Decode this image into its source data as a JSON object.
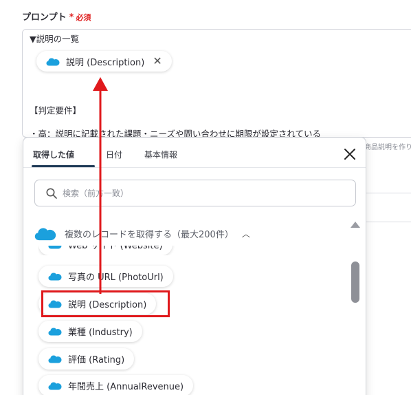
{
  "field": {
    "label": "プロンプト",
    "asterisk": "*",
    "required": "必須"
  },
  "prompt": {
    "line1": "▼説明の一覧",
    "chip_label": "説明 (Description)",
    "line2": "【判定要件】",
    "line3": "・高：説明に記載された課題・ニーズや問い合わせに期限が設定されている"
  },
  "background_hint": "商品説明を作り",
  "popup": {
    "tabs": [
      "取得した値",
      "日付",
      "基本情報"
    ],
    "search_placeholder": "検索（前方一致）",
    "group_title": "複数のレコードを取得する（最大200件）",
    "items": [
      "Web サイト (Website)",
      "写真の URL (PhotoUrl)",
      "説明 (Description)",
      "業種 (Industry)",
      "評価 (Rating)",
      "年間売上 (AnnualRevenue)"
    ]
  },
  "colors": {
    "salesforce_blue": "#1ba0dd",
    "highlight_red": "#e0191c",
    "tab_underline": "#1f3b57"
  }
}
